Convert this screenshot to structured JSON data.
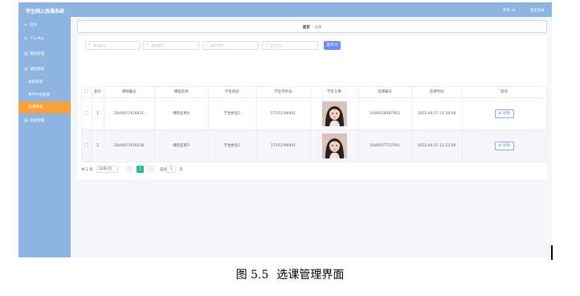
{
  "header": {
    "app_title": "学生网上选课系统",
    "user_label": "老师 a1",
    "logout_label": "退出登录"
  },
  "sidebar": {
    "items": [
      {
        "icon": "home-icon",
        "label": "首页"
      },
      {
        "icon": "user-icon",
        "label": "个人中心"
      },
      {
        "icon": "menu-icon",
        "label": "课程管理"
      },
      {
        "icon": "menu-icon",
        "label": "课程管理"
      },
      {
        "icon": "",
        "label": "课程管理"
      },
      {
        "icon": "",
        "label": "教学计划管理"
      },
      {
        "icon": "",
        "label": "选课管理"
      },
      {
        "icon": "menu-icon",
        "label": "成绩管理"
      }
    ],
    "active_index": 6,
    "active_color": "#f7a13a"
  },
  "breadcrumb": {
    "home": "首页",
    "separator": "/",
    "current": "选课"
  },
  "search": {
    "placeholders": [
      "课程编号",
      "课程编号",
      "课程名称",
      "学生姓名"
    ],
    "query_label": "查询 Q",
    "query_color": "#6d8ff5"
  },
  "table": {
    "columns": [
      "索引",
      "课程编号",
      "课程名称",
      "学生姓名",
      "学生手机号",
      "学生头像",
      "选课编号",
      "选课时间",
      "操作"
    ],
    "rows": [
      {
        "index": "1",
        "course_no": "1649057426031",
        "course_name": "课程名称4",
        "student_name": "学生姓名1",
        "phone": "17703786901",
        "select_no": "1649058087961",
        "select_time": "2022-04-07 21:28:08",
        "action": "详情"
      },
      {
        "index": "2",
        "course_no": "1649057426038",
        "course_name": "课程名称5",
        "student_name": "学生姓名1",
        "phone": "17703786901",
        "select_no": "1649057727591",
        "select_time": "2022-04-07 21:22:08",
        "action": "详情"
      }
    ]
  },
  "pagination": {
    "total": "共 2 条",
    "page_size": "10条/页",
    "prev": "<",
    "current_page": "1",
    "next": ">",
    "goto_label": "前往",
    "goto_value": "1",
    "goto_unit": "页",
    "active_color": "#22c08a"
  },
  "caption": {
    "number": "图 5.5",
    "text": "选课管理界面"
  }
}
